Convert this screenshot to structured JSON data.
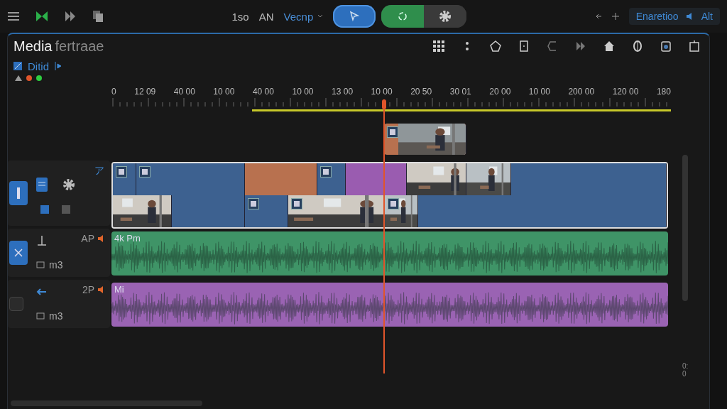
{
  "toolbar": {
    "readout": "1so",
    "font_label": "AN",
    "mode_label": "Vecnp",
    "mode_buttons": [
      {
        "kind": "select",
        "selected": true
      },
      {
        "kind": "cycle",
        "selected": true
      },
      {
        "kind": "settings",
        "selected": false
      }
    ],
    "side_panel_title": "Enaretioo",
    "side_label": "Alt"
  },
  "panel": {
    "title": "Media",
    "subtitle": "fertraae",
    "bin_label": "Ditid",
    "status_dots": [
      {
        "color": "#e0552b"
      },
      {
        "color": "#2ecc40"
      }
    ]
  },
  "ruler": {
    "labels": [
      "0",
      "12 09",
      "40 00",
      "10 00",
      "40 00",
      "10 00",
      "13 00",
      "10 00",
      "20 50",
      "30 01",
      "20 00",
      "10 00",
      "200 00",
      "120 00",
      "180"
    ]
  },
  "overlay_clips": [
    {
      "kind": "picture",
      "color": "#b8714f",
      "badge": true
    }
  ],
  "tracks": [
    {
      "kind": "video",
      "label": "ア",
      "enabled": true,
      "rows": [
        [
          {
            "kind": "color",
            "color": "#3d6190",
            "badge": true
          },
          {
            "kind": "color",
            "color": "#3d6190",
            "badge": true
          },
          {
            "kind": "color",
            "color": "#b8714f",
            "badge": false
          },
          {
            "kind": "color",
            "color": "#3d6190",
            "badge": true
          },
          {
            "kind": "color",
            "color": "#9a5cb0",
            "badge": false
          },
          {
            "kind": "picture",
            "badge": false
          },
          {
            "kind": "picture",
            "badge": false
          },
          {
            "kind": "color",
            "color": "#3d6190",
            "badge": false
          }
        ],
        [
          {
            "kind": "picture",
            "badge": false
          },
          {
            "kind": "color",
            "color": "#3d6190",
            "badge": false
          },
          {
            "kind": "color",
            "color": "#3d6190",
            "badge": true
          },
          {
            "kind": "picture",
            "badge": true
          },
          {
            "kind": "picture",
            "badge": true
          },
          {
            "kind": "color",
            "color": "#3d6190",
            "badge": false
          }
        ]
      ]
    },
    {
      "kind": "audio",
      "label": "AP",
      "format": "m3",
      "muted": true,
      "clip_label": "4k Pm",
      "color": "#3f9467"
    },
    {
      "kind": "audio",
      "label": "2P",
      "format": "m3",
      "muted": false,
      "clip_label": "Mi",
      "color": "#9a63b3"
    }
  ],
  "timecode": "0:0"
}
